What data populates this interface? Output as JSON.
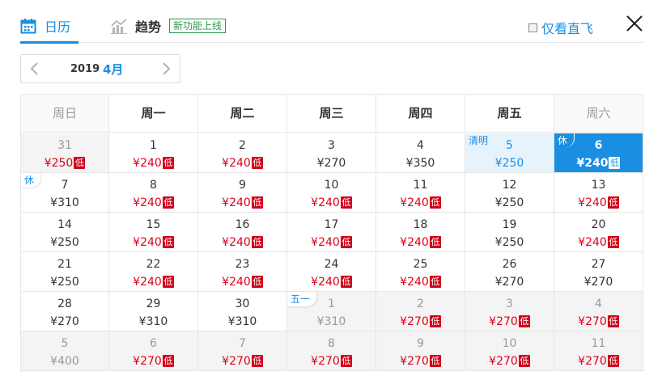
{
  "tabs": {
    "calendar": "日历",
    "trend": "趋势",
    "trend_badge": "新功能上线"
  },
  "direct_only": "仅看直飞",
  "close_icon": "close-icon",
  "month_nav": {
    "year": "2019",
    "month": "4月"
  },
  "weekdays": [
    "周日",
    "周一",
    "周二",
    "周三",
    "周四",
    "周五",
    "周六"
  ],
  "low_label": "低",
  "colors": {
    "accent": "#1a8ee1",
    "low_price": "#e0001b",
    "low_badge": "#d0021b",
    "selected_bg": "#1a8ee1",
    "holiday_bg": "#e6f3fd"
  },
  "weeks": [
    [
      {
        "day": "31",
        "price": "¥250",
        "low": true,
        "state": "gray"
      },
      {
        "day": "1",
        "price": "¥240",
        "low": true
      },
      {
        "day": "2",
        "price": "¥240",
        "low": true
      },
      {
        "day": "3",
        "price": "¥270"
      },
      {
        "day": "4",
        "price": "¥350"
      },
      {
        "day": "5",
        "price": "¥250",
        "state": "hl",
        "tag": "清明"
      },
      {
        "day": "6",
        "price": "¥240",
        "low": true,
        "state": "sel",
        "tag": "休"
      }
    ],
    [
      {
        "day": "7",
        "price": "¥310",
        "tag": "休"
      },
      {
        "day": "8",
        "price": "¥240",
        "low": true
      },
      {
        "day": "9",
        "price": "¥240",
        "low": true
      },
      {
        "day": "10",
        "price": "¥240",
        "low": true
      },
      {
        "day": "11",
        "price": "¥240",
        "low": true
      },
      {
        "day": "12",
        "price": "¥250"
      },
      {
        "day": "13",
        "price": "¥240",
        "low": true
      }
    ],
    [
      {
        "day": "14",
        "price": "¥250"
      },
      {
        "day": "15",
        "price": "¥240",
        "low": true
      },
      {
        "day": "16",
        "price": "¥240",
        "low": true
      },
      {
        "day": "17",
        "price": "¥240",
        "low": true
      },
      {
        "day": "18",
        "price": "¥240",
        "low": true
      },
      {
        "day": "19",
        "price": "¥250"
      },
      {
        "day": "20",
        "price": "¥240",
        "low": true
      }
    ],
    [
      {
        "day": "21",
        "price": "¥250"
      },
      {
        "day": "22",
        "price": "¥240",
        "low": true
      },
      {
        "day": "23",
        "price": "¥240",
        "low": true
      },
      {
        "day": "24",
        "price": "¥240",
        "low": true
      },
      {
        "day": "25",
        "price": "¥240",
        "low": true
      },
      {
        "day": "26",
        "price": "¥270"
      },
      {
        "day": "27",
        "price": "¥270"
      }
    ],
    [
      {
        "day": "28",
        "price": "¥270"
      },
      {
        "day": "29",
        "price": "¥310"
      },
      {
        "day": "30",
        "price": "¥310"
      },
      {
        "day": "1",
        "price": "¥310",
        "state": "gray",
        "tag": "五一"
      },
      {
        "day": "2",
        "price": "¥270",
        "low": true,
        "state": "gray"
      },
      {
        "day": "3",
        "price": "¥270",
        "low": true,
        "state": "gray"
      },
      {
        "day": "4",
        "price": "¥270",
        "low": true,
        "state": "gray"
      }
    ],
    [
      {
        "day": "5",
        "price": "¥400",
        "state": "gray"
      },
      {
        "day": "6",
        "price": "¥270",
        "low": true,
        "state": "gray"
      },
      {
        "day": "7",
        "price": "¥270",
        "low": true,
        "state": "gray"
      },
      {
        "day": "8",
        "price": "¥270",
        "low": true,
        "state": "gray"
      },
      {
        "day": "9",
        "price": "¥270",
        "low": true,
        "state": "gray"
      },
      {
        "day": "10",
        "price": "¥270",
        "low": true,
        "state": "gray"
      },
      {
        "day": "11",
        "price": "¥270",
        "low": true,
        "state": "gray"
      }
    ]
  ]
}
